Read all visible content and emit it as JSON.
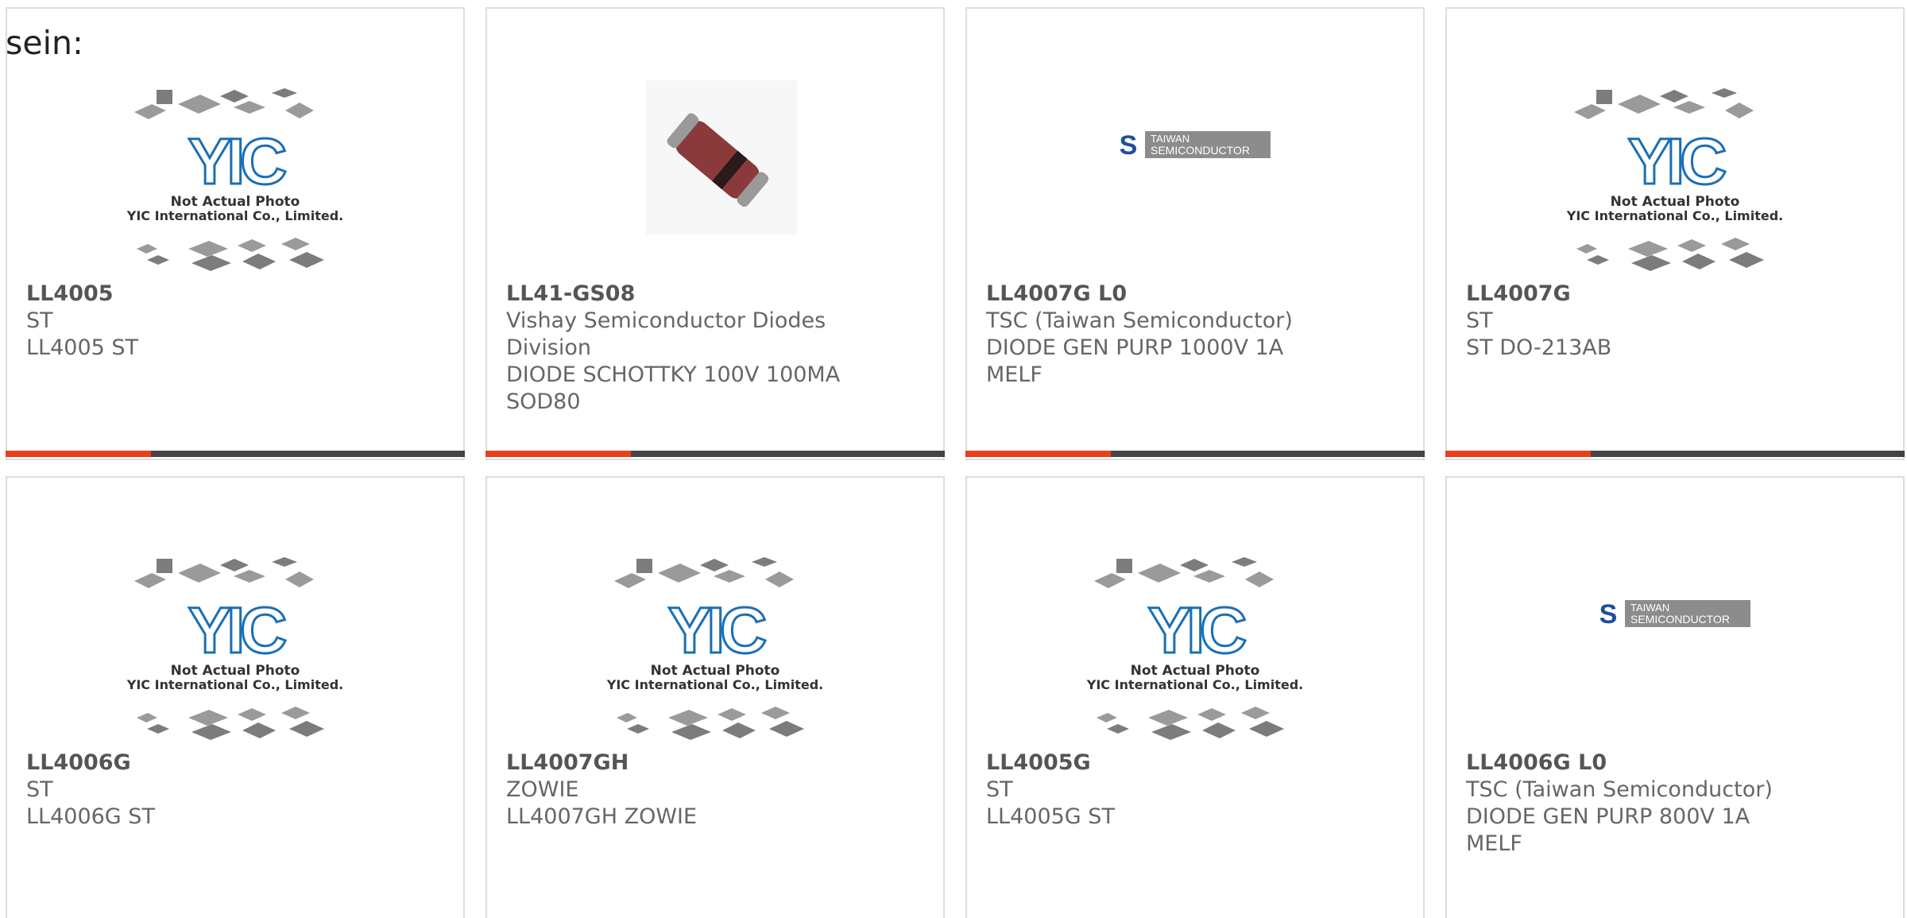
{
  "heading": "sein:",
  "colors": {
    "accent": "#e8401c",
    "bar": "#444444",
    "border": "#dddddd",
    "text": "#666666",
    "yic_blue": "#1a6fb5",
    "tsc_blue": "#1d4f9a"
  },
  "placeholder": {
    "line1": "Not Actual Photo",
    "line2": "YIC International Co., Limited.",
    "logo": "YIC"
  },
  "tsc_logo": {
    "line1": "TAIWAN",
    "line2": "SEMICONDUCTOR"
  },
  "products": [
    {
      "part_number": "LL4005",
      "manufacturer": "ST",
      "description": "LL4005 ST",
      "image": "yic-placeholder",
      "manufacturer_lines": [
        "ST"
      ],
      "description_lines": [
        "LL4005 ST"
      ]
    },
    {
      "part_number": "LL41-GS08",
      "manufacturer": "Vishay Semiconductor Diodes Division",
      "description": "DIODE SCHOTTKY 100V 100MA SOD80",
      "image": "melf-diode-photo",
      "manufacturer_lines": [
        "Vishay Semiconductor Diodes",
        "Division"
      ],
      "description_lines": [
        "DIODE SCHOTTKY 100V 100MA",
        "SOD80"
      ]
    },
    {
      "part_number": "LL4007G L0",
      "manufacturer": "TSC (Taiwan Semiconductor)",
      "description": "DIODE GEN PURP 1000V 1A MELF",
      "image": "taiwan-semiconductor-logo",
      "manufacturer_lines": [
        "TSC (Taiwan Semiconductor)"
      ],
      "description_lines": [
        "DIODE GEN PURP 1000V 1A MELF"
      ]
    },
    {
      "part_number": "LL4007G",
      "manufacturer": "ST",
      "description": "ST DO-213AB",
      "image": "yic-placeholder",
      "manufacturer_lines": [
        "ST"
      ],
      "description_lines": [
        "ST DO-213AB"
      ]
    },
    {
      "part_number": "LL4006G",
      "manufacturer": "ST",
      "description": "LL4006G ST",
      "image": "yic-placeholder",
      "manufacturer_lines": [
        "ST"
      ],
      "description_lines": [
        "LL4006G ST"
      ]
    },
    {
      "part_number": "LL4007GH",
      "manufacturer": "ZOWIE",
      "description": "LL4007GH ZOWIE",
      "image": "yic-placeholder",
      "manufacturer_lines": [
        "ZOWIE"
      ],
      "description_lines": [
        "LL4007GH ZOWIE"
      ]
    },
    {
      "part_number": "LL4005G",
      "manufacturer": "ST",
      "description": "LL4005G ST",
      "image": "yic-placeholder",
      "manufacturer_lines": [
        "ST"
      ],
      "description_lines": [
        "LL4005G ST"
      ]
    },
    {
      "part_number": "LL4006G L0",
      "manufacturer": "TSC (Taiwan Semiconductor)",
      "description": "DIODE GEN PURP 800V 1A MELF",
      "image": "taiwan-semiconductor-logo",
      "manufacturer_lines": [
        "TSC (Taiwan Semiconductor)"
      ],
      "description_lines": [
        "DIODE GEN PURP 800V 1A MELF"
      ]
    }
  ]
}
